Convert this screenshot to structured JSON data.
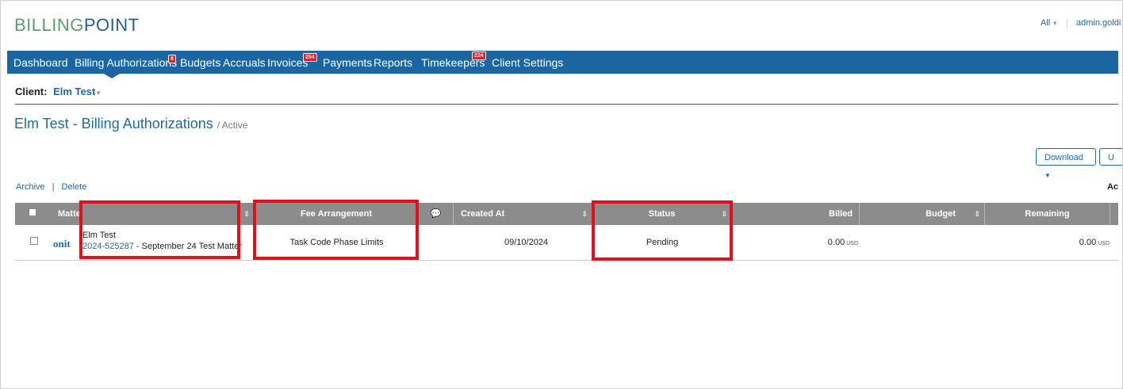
{
  "brand": {
    "part1": "BILLING",
    "part2": "POINT"
  },
  "top_right": {
    "scope": "All",
    "user": "admin.goldi"
  },
  "nav": {
    "items": [
      {
        "label": "Dashboard"
      },
      {
        "label": "Billing Authorizations",
        "badge": "8"
      },
      {
        "label": "Budgets"
      },
      {
        "label": "Accruals"
      },
      {
        "label": "Invoices",
        "badge": "254"
      },
      {
        "label": "Payments"
      },
      {
        "label": "Reports"
      },
      {
        "label": "Timekeepers",
        "badge": "224"
      },
      {
        "label": "Client Settings"
      }
    ]
  },
  "client": {
    "label": "Client:",
    "value": "Elm Test"
  },
  "page": {
    "title": "Elm Test - Billing Authorizations",
    "subtitle": "/ Active"
  },
  "toolbar": {
    "download_label": "Download",
    "second_label": "U"
  },
  "actions": {
    "archive": "Archive",
    "delete": "Delete",
    "right_label": "Ac"
  },
  "table": {
    "headers": {
      "matter": "Matte",
      "fee_arrangement": "Fee Arrangement",
      "created_at": "Created At",
      "status": "Status",
      "billed": "Billed",
      "budget": "Budget",
      "remaining": "Remaining"
    },
    "rows": [
      {
        "logo": "onit",
        "client": "Elm Test",
        "matter_number": "2024-525287",
        "matter_name": "- September 24 Test Matter",
        "fee_arrangement": "Task Code Phase Limits",
        "created_at": "09/10/2024",
        "status": "Pending",
        "billed": "0.00",
        "billed_currency": "USD",
        "remaining": "0.00",
        "remaining_currency": "USD"
      }
    ]
  },
  "highlight_color": "#e0101c",
  "nav_color": "#1966a3"
}
